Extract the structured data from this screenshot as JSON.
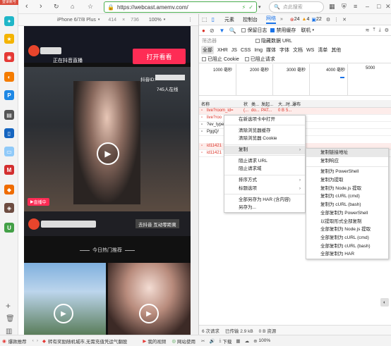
{
  "browser": {
    "login_badge": "登录账号",
    "url": "https://webcast.amemv.com/",
    "search_placeholder": "点此搜索",
    "status": {
      "errors": "24",
      "warnings": "4",
      "messages": "22"
    }
  },
  "device_bar": {
    "device": "iPhone 6/7/8 Plus",
    "width": "414",
    "height": "736",
    "zoom": "100%"
  },
  "phone": {
    "header_text": "正在抖音直播",
    "open_button": "打开看看",
    "douyin_id_label": "抖音ID:",
    "online_count": "745人在线",
    "live_badge": "直播中",
    "bottom_banner": "去抖音 互动零距离",
    "recommend_title": "今日热门推荐"
  },
  "devtools": {
    "tabs": [
      "元素",
      "控制台",
      "网络"
    ],
    "toolbar": {
      "preserve_log": "保留日志",
      "disable_cache": "禁用缓存",
      "online": "联机"
    },
    "filter_placeholder": "筛选器",
    "hide_data_url": "隐藏数据 URL",
    "type_filters": [
      "全部",
      "XHR",
      "JS",
      "CSS",
      "Img",
      "媒体",
      "字体",
      "文档",
      "WS",
      "清单",
      "其他"
    ],
    "blocked_cookie": "已阻止 Cookie",
    "blocked_requests": "已阻止请求",
    "timeline_ticks": [
      "1000 毫秒",
      "2000 毫秒",
      "3000 毫秒",
      "4000 毫秒",
      "5000"
    ],
    "columns": [
      "名称",
      "状",
      "类...",
      "发起...",
      "大...",
      "时...",
      "瀑布"
    ],
    "rows": [
      {
        "name": "live?room_id=",
        "status": "(...",
        "type": "do...",
        "initiator": "PAT...",
        "size": "0 B",
        "time": "5..."
      },
      {
        "name": "live?roo",
        "status": "",
        "type": "",
        "initiator": "",
        "size": "",
        "time": ""
      },
      {
        "name": "?ev_type",
        "status": "",
        "type": "",
        "initiator": "",
        "size": "",
        "time": ""
      },
      {
        "name": "PggQ/",
        "status": "",
        "type": "",
        "initiator": "",
        "size": "",
        "time": ""
      },
      {
        "name": "id11421",
        "status": "",
        "type": "",
        "initiator": "",
        "size": "",
        "time": ""
      },
      {
        "name": "id11421",
        "status": "",
        "type": "",
        "initiator": "",
        "size": "",
        "time": ""
      }
    ],
    "status_bar": {
      "requests": "6 次请求",
      "transferred": "已传输 2.9 kB",
      "resources": "0 B 资源"
    }
  },
  "context_menu": {
    "items": [
      {
        "label": "在新选项卡中打开",
        "submenu": false
      },
      {
        "sep": true
      },
      {
        "label": "清除浏览器缓存",
        "submenu": false
      },
      {
        "label": "清除浏览器 Cookie",
        "submenu": false
      },
      {
        "sep": true
      },
      {
        "label": "复制",
        "submenu": true,
        "highlighted": true
      },
      {
        "sep": true
      },
      {
        "label": "阻止请求 URL",
        "submenu": false
      },
      {
        "label": "阻止请求域",
        "submenu": false
      },
      {
        "sep": true
      },
      {
        "label": "排序方式",
        "submenu": true
      },
      {
        "label": "标题选项",
        "submenu": true
      },
      {
        "sep": true
      },
      {
        "label": "全部另存为 HAR (含内容)",
        "submenu": false
      },
      {
        "label": "另存为...",
        "submenu": false
      }
    ]
  },
  "copy_submenu": {
    "items": [
      {
        "label": "复制链接地址",
        "highlighted": true
      },
      {
        "label": "复制响应"
      },
      {
        "sep": true
      },
      {
        "label": "复制为 PowerShell"
      },
      {
        "label": "复制为提取"
      },
      {
        "label": "复制为 Node.js 提取"
      },
      {
        "label": "复制为 cURL (cmd)"
      },
      {
        "label": "复制为 cURL (bash)"
      },
      {
        "label": "全部复制为 PowerShell"
      },
      {
        "label": "以提取形式全部复制"
      },
      {
        "label": "全部复制为 Node.js 提取"
      },
      {
        "label": "全部复制为 cURL (cmd)"
      },
      {
        "label": "全部复制为 cURL (bash)"
      },
      {
        "label": "全部复制为 HAR"
      }
    ]
  },
  "bottom_bar": {
    "recommend": "爆款推荐",
    "news": "转有奖励随机城市,无需充值凭运气翻股",
    "video": "我的视频",
    "network": "网站使用",
    "download": "下载",
    "zoom": "100%"
  },
  "colors": {
    "accent": "#fe2c55",
    "green": "#4caf50",
    "devtools_blue": "#1a73e8",
    "selected": "#d6e6fb"
  }
}
